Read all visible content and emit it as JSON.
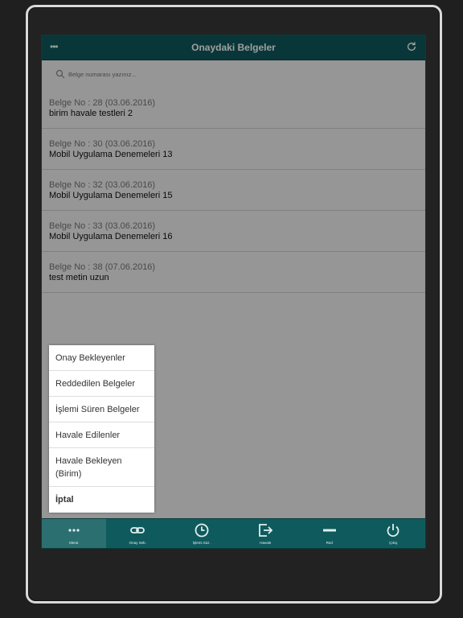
{
  "header": {
    "title": "Onaydaki Belgeler"
  },
  "search": {
    "placeholder": "Belge numarası yazınız..."
  },
  "documents": [
    {
      "meta": "Belge No : 28 (03.06.2016)",
      "desc": "birim havale testleri 2"
    },
    {
      "meta": "Belge No : 30 (03.06.2016)",
      "desc": "Mobil Uygulama Denemeleri 13"
    },
    {
      "meta": "Belge No : 32 (03.06.2016)",
      "desc": "Mobil Uygulama Denemeleri 15"
    },
    {
      "meta": "Belge No : 33 (03.06.2016)",
      "desc": "Mobil Uygulama Denemeleri 16"
    },
    {
      "meta": "Belge No : 38 (07.06.2016)",
      "desc": "test metin uzun"
    }
  ],
  "popup": {
    "options": [
      "Onay Bekleyenler",
      "Reddedilen Belgeler",
      "İşlemi Süren Belgeler",
      "Havale Edilenler",
      "Havale Bekleyen (Birim)",
      "İptal"
    ]
  },
  "tabs": [
    {
      "label": "Menü",
      "icon": "dots-icon"
    },
    {
      "label": "Onay Seb.",
      "icon": "link-icon"
    },
    {
      "label": "İşlemi Süz.",
      "icon": "clock-icon"
    },
    {
      "label": "Havale",
      "icon": "export-icon"
    },
    {
      "label": "Red",
      "icon": "minus-icon"
    },
    {
      "label": "Çıkış",
      "icon": "power-icon"
    }
  ],
  "colors": {
    "header": "#0f5a5c",
    "active_tab": "#2b6f71",
    "background": "#1f1f1f"
  }
}
